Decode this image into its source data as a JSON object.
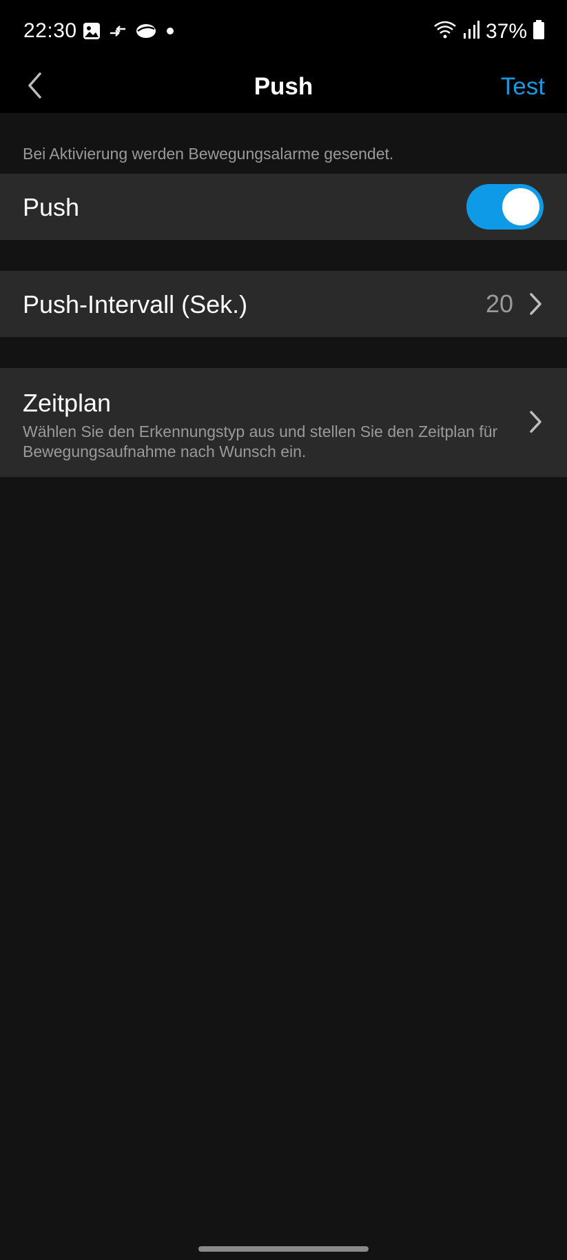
{
  "status_bar": {
    "time": "22:30",
    "battery_percent": "37%",
    "left_icons": [
      "gallery-icon",
      "data-transfer-icon",
      "cloud-icon",
      "dot-icon"
    ],
    "right_icons": [
      "wifi-icon",
      "signal-icon",
      "battery-icon"
    ]
  },
  "nav": {
    "title": "Push",
    "action_label": "Test",
    "back_icon": "chevron-left-icon"
  },
  "hint": "Bei Aktivierung werden Bewegungsalarme gesendet.",
  "settings": {
    "push": {
      "label": "Push",
      "enabled": true
    },
    "interval": {
      "label": "Push-Intervall (Sek.)",
      "value": "20"
    },
    "schedule": {
      "label": "Zeitplan",
      "description": "Wählen Sie den Erkennungstyp aus und stellen Sie den Zeitplan für Bewegungsaufnahme nach Wunsch ein."
    }
  },
  "colors": {
    "accent": "#1a97e0",
    "toggle_on": "#0e9ae6",
    "background": "#131313",
    "row_background": "#2a2a2a",
    "secondary_text": "#9a9a9a"
  }
}
